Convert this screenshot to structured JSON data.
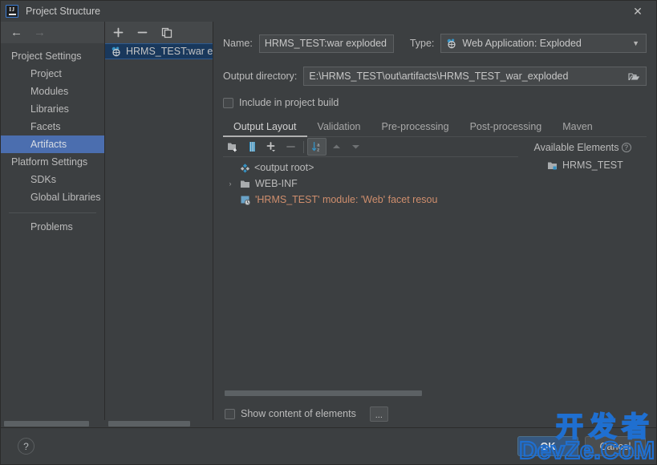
{
  "window": {
    "title": "Project Structure",
    "app_icon": "intellij-idea-icon",
    "close_label": "✕"
  },
  "nav": {
    "back_label": "←",
    "forward_label": "→",
    "groups": [
      {
        "label": "Project Settings",
        "items": [
          {
            "label": "Project",
            "selected": false
          },
          {
            "label": "Modules",
            "selected": false
          },
          {
            "label": "Libraries",
            "selected": false
          },
          {
            "label": "Facets",
            "selected": false
          },
          {
            "label": "Artifacts",
            "selected": true
          }
        ]
      },
      {
        "label": "Platform Settings",
        "items": [
          {
            "label": "SDKs",
            "selected": false
          },
          {
            "label": "Global Libraries",
            "selected": false
          }
        ]
      }
    ],
    "problems_label": "Problems"
  },
  "artifact_list": {
    "toolbar": [
      {
        "name": "add-artifact-button",
        "label": "+"
      },
      {
        "name": "remove-artifact-button",
        "label": "−"
      },
      {
        "name": "copy-artifact-button",
        "label": "copy-icon"
      }
    ],
    "items": [
      {
        "label": "HRMS_TEST:war exploded",
        "icon": "artifact-icon",
        "selected": true
      }
    ]
  },
  "detail": {
    "name_label": "Name:",
    "name_value": "HRMS_TEST:war exploded",
    "type_label": "Type:",
    "type_value": "Web Application: Exploded",
    "type_icon": "artifact-icon",
    "output_dir_label": "Output directory:",
    "output_dir_value": "E:\\HRMS_TEST\\out\\artifacts\\HRMS_TEST_war_exploded",
    "browse_icon": "folder-open-icon",
    "include_in_build_label": "Include in project build",
    "include_in_build_checked": false,
    "tabs": [
      {
        "label": "Output Layout",
        "active": true
      },
      {
        "label": "Validation",
        "active": false
      },
      {
        "label": "Pre-processing",
        "active": false
      },
      {
        "label": "Post-processing",
        "active": false
      },
      {
        "label": "Maven",
        "active": false
      }
    ]
  },
  "layout": {
    "toolbar": [
      {
        "name": "create-directory-button",
        "icon": "folder-add-icon",
        "pressed": false,
        "disabled": false
      },
      {
        "name": "create-archive-button",
        "icon": "archive-icon",
        "pressed": false,
        "disabled": false
      },
      {
        "name": "add-copy-of-button",
        "icon": "plus-dropdown-icon",
        "pressed": false,
        "disabled": false
      },
      {
        "name": "remove-element-button",
        "icon": "minus-icon",
        "pressed": false,
        "disabled": true
      },
      {
        "name": "sort-elements-button",
        "icon": "sort-az-icon",
        "pressed": true,
        "disabled": false
      },
      {
        "name": "move-up-button",
        "icon": "arrow-up-icon",
        "pressed": false,
        "disabled": true
      },
      {
        "name": "move-down-button",
        "icon": "arrow-down-icon",
        "pressed": false,
        "disabled": true
      }
    ],
    "tree": [
      {
        "label": "<output root>",
        "icon": "output-root-icon",
        "indent": 0,
        "twisty": "",
        "warn": false
      },
      {
        "label": "WEB-INF",
        "icon": "folder-icon",
        "indent": 1,
        "twisty": "›",
        "warn": false
      },
      {
        "label": "'HRMS_TEST' module: 'Web' facet resou",
        "icon": "facet-resource-icon",
        "indent": 1,
        "twisty": "",
        "warn": true
      }
    ],
    "available_elements_label": "Available Elements",
    "available_help_label": "?",
    "available_items": [
      {
        "label": "HRMS_TEST",
        "icon": "module-icon"
      }
    ],
    "show_content_label": "Show content of elements",
    "show_content_checked": false,
    "more_button_label": "..."
  },
  "footer": {
    "help_label": "?",
    "ok_label": "OK",
    "cancel_label": "Cancel"
  },
  "watermark": {
    "line1": "开发者",
    "line2": "DevZe.CoM",
    "color": "#1f6fd0"
  }
}
